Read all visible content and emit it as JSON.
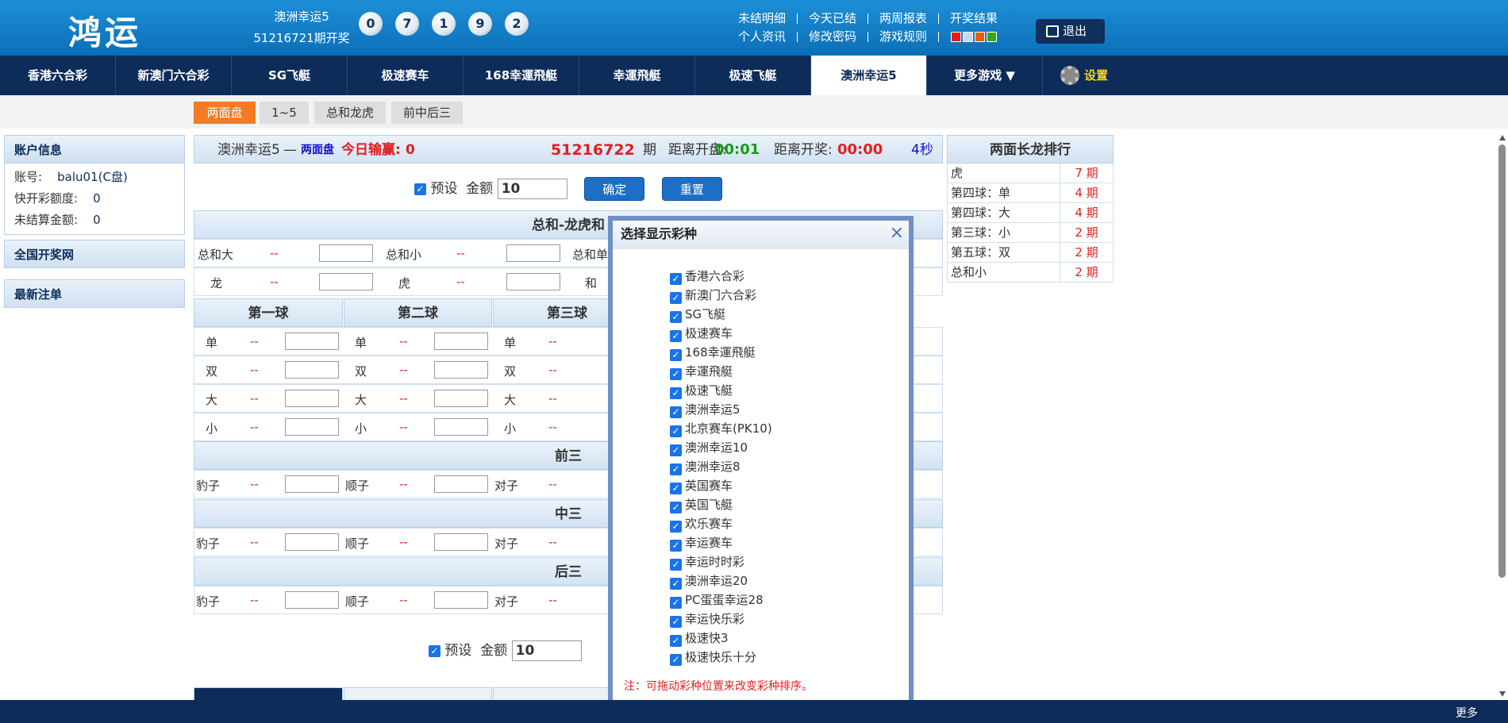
{
  "header": {
    "logo": "鸿运",
    "game_name": "澳洲幸运5",
    "draw_issue": "51216721期开奖",
    "balls": [
      "0",
      "7",
      "1",
      "9",
      "2"
    ],
    "links_row1": [
      "未结明细",
      "今天已结",
      "两周报表",
      "开奖结果"
    ],
    "links_row2": [
      "个人资讯",
      "修改密码",
      "游戏规则"
    ],
    "swatch_colors": [
      "#e81a1a",
      "#c9d8ee",
      "#e85c00",
      "#3aa814"
    ],
    "logout_label": "退出"
  },
  "nav": {
    "items": [
      "香港六合彩",
      "新澳门六合彩",
      "SG飞艇",
      "极速赛车",
      "168幸運飛艇",
      "幸運飛艇",
      "极速飞艇",
      "澳洲幸运5"
    ],
    "more_label": "更多游戏 ▼",
    "settings_label": "设置"
  },
  "subtabs": [
    "两面盘",
    "1~5",
    "总和龙虎",
    "前中后三"
  ],
  "account": {
    "title": "账户信息",
    "account_label": "账号:",
    "account_value": "balu01(C盘)",
    "quota_label": "快开彩额度:",
    "quota_value": "0",
    "unsettled_label": "未结算金额:",
    "unsettled_value": "0",
    "link1": "全国开奖网",
    "link2": "最新注单"
  },
  "topbar": {
    "game": "澳洲幸运5",
    "dash": "—",
    "mode": "两面盘",
    "today_label": "今日输赢:",
    "today_value": "0",
    "issue": "51216722",
    "issue_suffix": "期",
    "close_label": "距离开盘:",
    "close_value": "00:01",
    "open_label": "距离开奖:",
    "open_value": "00:00",
    "countdown": "4秒"
  },
  "form": {
    "preset_label": "预设",
    "amount_label": "金额",
    "amount_value": "10",
    "confirm": "确定",
    "reset": "重置"
  },
  "sections": {
    "sum_title": "总和-龙虎和",
    "sum_row1": [
      "总和大",
      "--",
      "总和小",
      "--",
      "总和单"
    ],
    "sum_row2": [
      "龙",
      "--",
      "虎",
      "--",
      "和"
    ],
    "balls": [
      "第一球",
      "第二球",
      "第三球"
    ],
    "ball_rows": [
      "单",
      "双",
      "大",
      "小"
    ],
    "odds": "--",
    "front": "前三",
    "mid": "中三",
    "back": "后三",
    "three_items": [
      "豹子",
      "顺子",
      "对子"
    ]
  },
  "ranking": {
    "title": "两面长龙排行",
    "rows": [
      {
        "name": "虎",
        "val": "7 期"
      },
      {
        "name": "第四球：单",
        "val": "4 期"
      },
      {
        "name": "第四球：大",
        "val": "4 期"
      },
      {
        "name": "第三球：小",
        "val": "2 期"
      },
      {
        "name": "第五球：双",
        "val": "2 期"
      },
      {
        "name": "总和小",
        "val": "2 期"
      }
    ]
  },
  "modal": {
    "title": "选择显示彩种",
    "close": "×",
    "options": [
      "香港六合彩",
      "新澳门六合彩",
      "SG飞艇",
      "极速赛车",
      "168幸運飛艇",
      "幸運飛艇",
      "极速飞艇",
      "澳洲幸运5",
      "北京赛车(PK10)",
      "澳洲幸运10",
      "澳洲幸运8",
      "英国赛车",
      "英国飞艇",
      "欢乐赛车",
      "幸运赛车",
      "幸运时时彩",
      "澳洲幸运20",
      "PC蛋蛋幸运28",
      "幸运快乐彩",
      "极速快3",
      "极速快乐十分"
    ],
    "note": "注：可拖动彩种位置来改变彩种排序。"
  },
  "footer": {
    "more": "更多"
  }
}
